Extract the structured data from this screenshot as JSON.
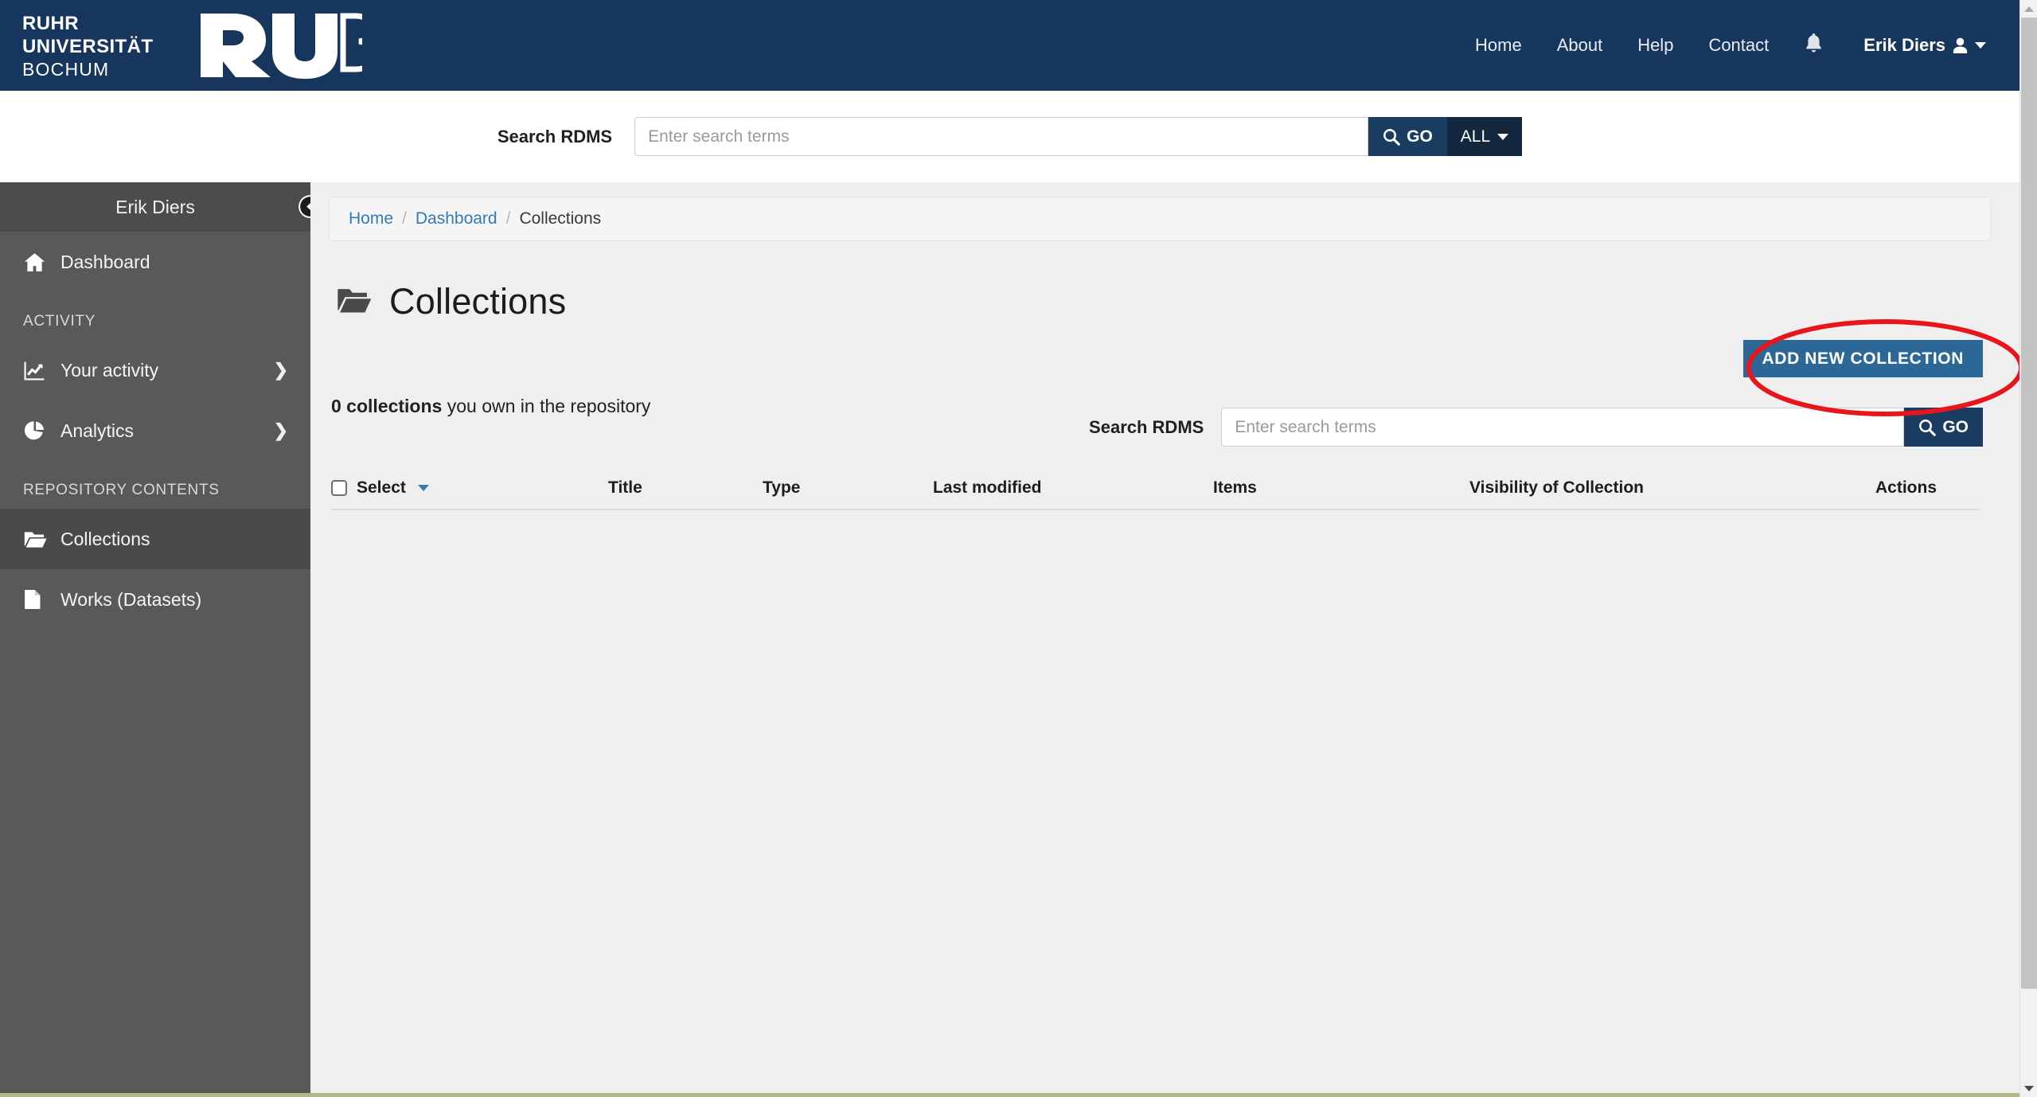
{
  "brand": {
    "line1": "RUHR",
    "line2": "UNIVERSITÄT",
    "line3": "BOCHUM",
    "logotype": "RUB",
    "bar_color": "#17365d"
  },
  "topnav": {
    "items": [
      {
        "label": "Home"
      },
      {
        "label": "About"
      },
      {
        "label": "Help"
      },
      {
        "label": "Contact"
      }
    ],
    "notifications_icon": "bell-icon",
    "user": {
      "name": "Erik Diers",
      "icon": "user-icon",
      "caret": "chevron-down-icon"
    }
  },
  "global_search": {
    "label": "Search RDMS",
    "placeholder": "Enter search terms",
    "value": "",
    "go_label": "GO",
    "scope_label": "ALL"
  },
  "sidebar": {
    "header": "Erik Diers",
    "collapse_icon": "chevron-left-circle-icon",
    "items": [
      {
        "label": "Dashboard",
        "icon": "home-icon",
        "active": false,
        "chevron": false
      }
    ],
    "sections": [
      {
        "title": "ACTIVITY",
        "items": [
          {
            "label": "Your activity",
            "icon": "line-chart-icon",
            "active": false,
            "chevron": true
          },
          {
            "label": "Analytics",
            "icon": "pie-chart-icon",
            "active": false,
            "chevron": true
          }
        ]
      },
      {
        "title": "REPOSITORY CONTENTS",
        "items": [
          {
            "label": "Collections",
            "icon": "folder-open-icon",
            "active": true,
            "chevron": false
          },
          {
            "label": "Works (Datasets)",
            "icon": "file-icon",
            "active": false,
            "chevron": false
          }
        ]
      }
    ]
  },
  "breadcrumb": {
    "items": [
      {
        "label": "Home",
        "link": true
      },
      {
        "label": "Dashboard",
        "link": true
      },
      {
        "label": "Collections",
        "link": false
      }
    ],
    "separator": "/"
  },
  "page": {
    "title": "Collections",
    "title_icon": "folder-open-icon",
    "add_button": "ADD NEW COLLECTION",
    "count_bold": "0 collections",
    "count_rest": " you own in the repository"
  },
  "inner_search": {
    "label": "Search RDMS",
    "placeholder": "Enter search terms",
    "value": "",
    "go_label": "GO"
  },
  "table": {
    "select_label": "Select",
    "columns": [
      "Title",
      "Type",
      "Last modified",
      "Items",
      "Visibility of Collection",
      "Actions"
    ],
    "rows": []
  },
  "annotation": {
    "shape": "ellipse",
    "color": "#e8151d",
    "target": "ADD NEW COLLECTION"
  },
  "colors": {
    "header_navy": "#17365d",
    "sidebar_gray": "#595959",
    "sidebar_active": "#4a4a4a",
    "primary_button": "#2b6898",
    "go_button": "#1b3c61",
    "link_blue": "#337ab7",
    "content_bg": "#efefef"
  }
}
